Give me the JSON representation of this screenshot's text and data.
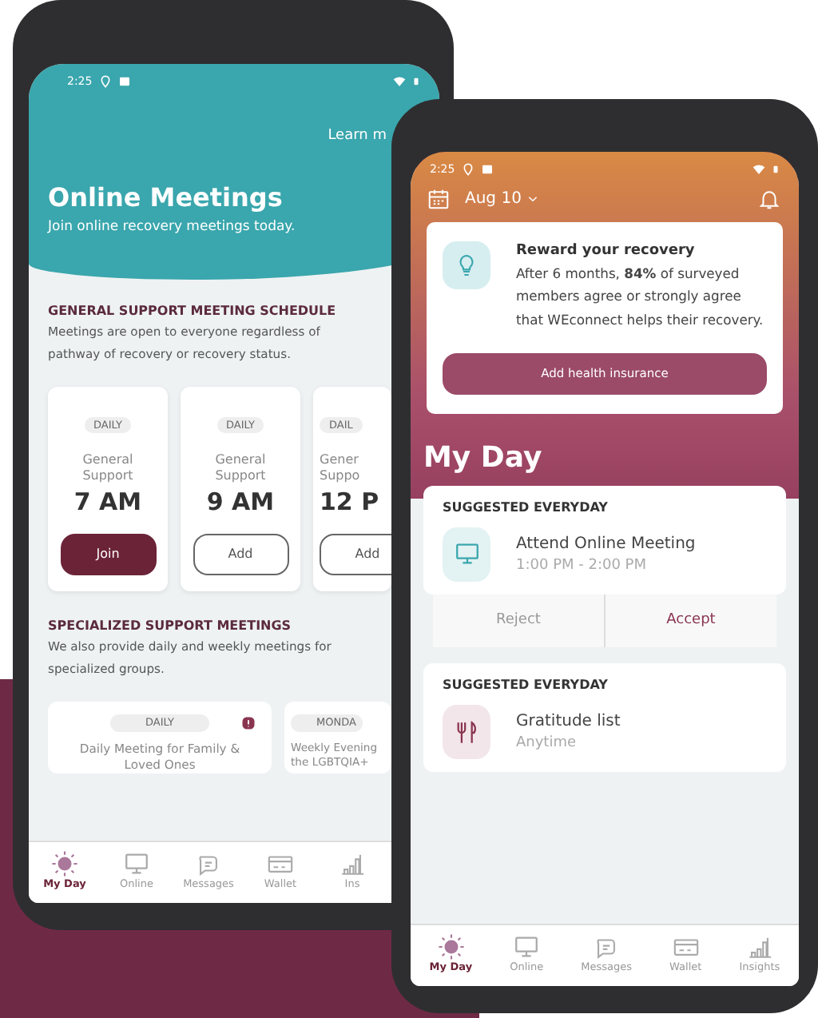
{
  "meetings_screen": {
    "status_bar": {
      "time": "2:25"
    },
    "link": "Learn m",
    "title": "Online Meetings",
    "subtitle": "Join online recovery meetings today.",
    "general_section": {
      "heading": "GENERAL SUPPORT MEETING SCHEDULE",
      "description": "Meetings are open to everyone regardless of pathway of recovery or recovery status.",
      "meetings": [
        {
          "frequency": "DAILY",
          "lines": [
            "General",
            "Support"
          ],
          "time": "7 AM",
          "action": "Join",
          "kind": "primary"
        },
        {
          "frequency": "DAILY",
          "lines": [
            "General",
            "Support"
          ],
          "time": "9 AM",
          "action": "Add",
          "kind": "outline"
        },
        {
          "frequency": "DAIL",
          "lines": [
            "Gener",
            "Suppo"
          ],
          "time": "12 P",
          "action": "Add",
          "kind": "outline"
        }
      ]
    },
    "specialized_section": {
      "heading": "SPECIALIZED SUPPORT MEETINGS",
      "description": "We also provide daily and weekly meetings for specialized groups.",
      "groups": [
        {
          "frequency": "DAILY",
          "lines": [
            "Daily Meeting for Family &",
            "Loved Ones"
          ]
        },
        {
          "frequency": "MONDA",
          "lines": [
            "Weekly Evening",
            "the LGBTQIA+"
          ]
        }
      ]
    },
    "nav": [
      {
        "label": "My Day",
        "selected": true,
        "kind": "sun"
      },
      {
        "label": "Online",
        "selected": false,
        "kind": "monitor"
      },
      {
        "label": "Messages",
        "selected": false,
        "kind": "chat"
      },
      {
        "label": "Wallet",
        "selected": false,
        "kind": "card"
      },
      {
        "label": "Ins",
        "selected": false,
        "kind": "chart"
      }
    ]
  },
  "my_day_screen": {
    "status_bar": {
      "time": "2:25"
    },
    "date": "Aug 10",
    "promo": {
      "title": "Reward your recovery",
      "body": "After 6 months, **84%** of surveyed members agree or strongly agree that WEconnect helps their recovery.",
      "button": "Add health insurance"
    },
    "heading": "My Day",
    "suggestions": [
      {
        "tag": "SUGGESTED EVERYDAY",
        "title": "Attend Online Meeting",
        "time": "1:00 PM - 2:00 PM",
        "kind": "monitor",
        "actions": [
          "Reject",
          "Accept"
        ]
      },
      {
        "tag": "SUGGESTED EVERYDAY",
        "title": "Gratitude list",
        "time": "Anytime",
        "kind": "utensils"
      }
    ],
    "nav": [
      {
        "label": "My Day",
        "selected": true,
        "kind": "sun"
      },
      {
        "label": "Online",
        "selected": false,
        "kind": "monitor"
      },
      {
        "label": "Messages",
        "selected": false,
        "kind": "chat"
      },
      {
        "label": "Wallet",
        "selected": false,
        "kind": "card"
      },
      {
        "label": "Insights",
        "selected": false,
        "kind": "chart"
      }
    ]
  }
}
